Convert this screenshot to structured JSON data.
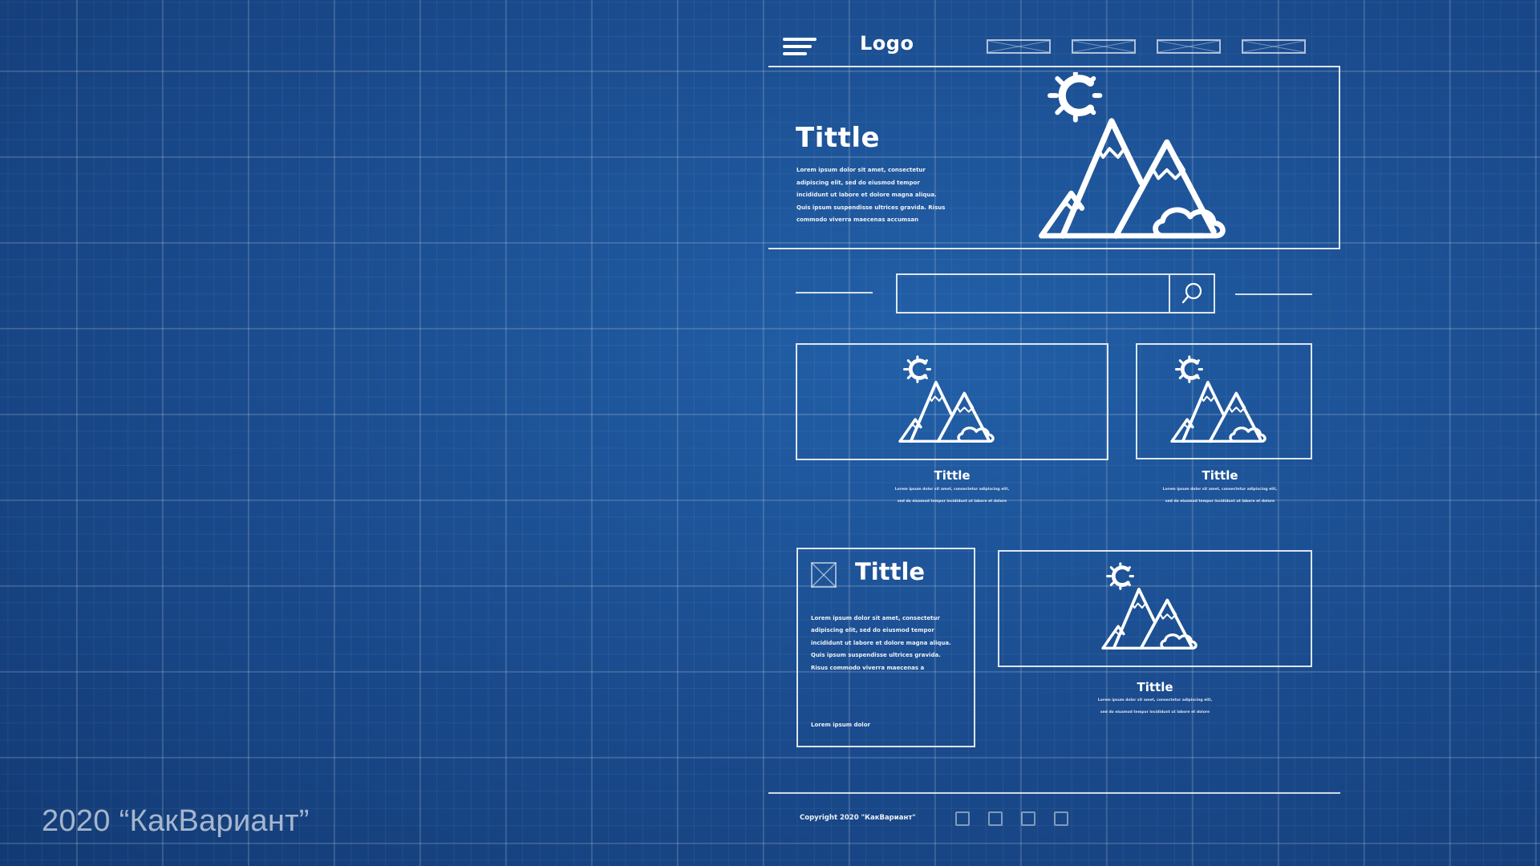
{
  "header": {
    "logo": "Logo",
    "nav_items": [
      "",
      "",
      "",
      ""
    ]
  },
  "hero": {
    "title": "Tittle",
    "text": "Lorem ipsum dolor sit amet, consectetur adipiscing elit, sed do eiusmod tempor incididunt ut labore et dolore magna aliqua. Quis ipsum suspendisse ultrices gravida. Risus commodo viverra maecenas accumsan"
  },
  "search": {
    "placeholder": "",
    "icon": "search-icon"
  },
  "cards": [
    {
      "title": "Tittle",
      "text_line1": "Lorem ipsum dolor sit amet, consectetur adipiscing elit,",
      "text_line2": "sed do eiusmod tempor incididunt ut labore et dolore"
    },
    {
      "title": "Tittle",
      "text_line1": "Lorem ipsum dolor sit amet, consectetur adipiscing elit,",
      "text_line2": "sed do eiusmod tempor incididunt ut labore et dolore"
    },
    {
      "title": "Tittle",
      "text_line1": "Lorem ipsum dolor sit amet, consectetur adipiscing elit,",
      "text_line2": "sed do eiusmod tempor incididunt ut labore et dolore"
    }
  ],
  "text_card": {
    "title": "Tittle",
    "text": "Lorem ipsum dolor sit amet, consectetur adipiscing elit, sed do eiusmod tempor incididunt ut labore et dolore magna aliqua. Quis ipsum suspendisse ultrices gravida. Risus commodo viverra maecenas a",
    "footer": "Lorem ipsum dolor"
  },
  "footer": {
    "copyright": "Copyright 2020 \"КакВариант\""
  },
  "watermark": "2020 “КакВариант”",
  "colors": {
    "background": "#1d4f93",
    "line": "#ffffff"
  }
}
